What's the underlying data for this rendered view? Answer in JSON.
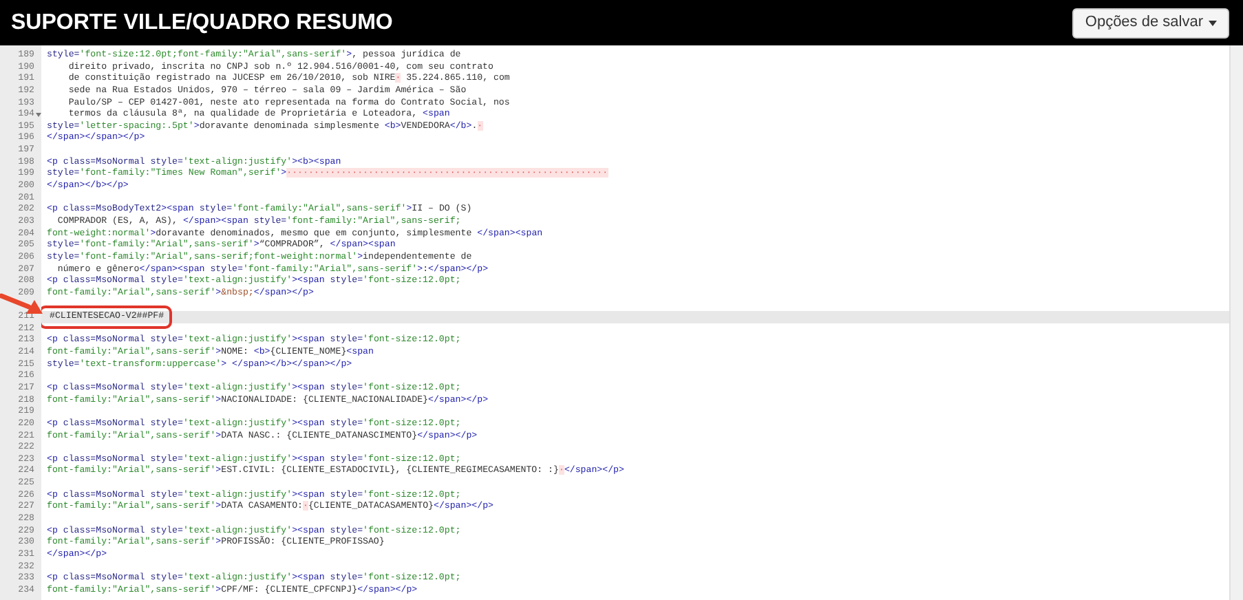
{
  "header": {
    "title": "SUPORTE VILLE/QUADRO RESUMO",
    "save_button": "Opções de salvar"
  },
  "editor": {
    "lines": [
      {
        "number": "189",
        "fold": false,
        "active": false,
        "boxed": false,
        "segments": [
          {
            "kind": "attr",
            "text": "style="
          },
          {
            "kind": "string",
            "text": "'font-size:12.0pt;font-family:\"Arial\",sans-serif'"
          },
          {
            "kind": "tag",
            "text": ">"
          },
          {
            "kind": "text",
            "text": ", pessoa jurídica de"
          }
        ]
      },
      {
        "number": "190",
        "fold": false,
        "active": false,
        "boxed": false,
        "segments": [
          {
            "kind": "text",
            "text": "    direito privado, inscrita no CNPJ sob n.º 12.904.516/0001-40, com seu contrato"
          }
        ]
      },
      {
        "number": "191",
        "fold": false,
        "active": false,
        "boxed": false,
        "segments": [
          {
            "kind": "text",
            "text": "    de constituição registrado na JUCESP em 26/10/2010, sob NIRE"
          },
          {
            "kind": "invisible",
            "text": "·"
          },
          {
            "kind": "text",
            "text": " 35.224.865.110, com"
          }
        ]
      },
      {
        "number": "192",
        "fold": false,
        "active": false,
        "boxed": false,
        "segments": [
          {
            "kind": "text",
            "text": "    sede na Rua Estados Unidos, 970 – térreo – sala 09 – Jardim América – São"
          }
        ]
      },
      {
        "number": "193",
        "fold": false,
        "active": false,
        "boxed": false,
        "segments": [
          {
            "kind": "text",
            "text": "    Paulo/SP – CEP 01427-001, neste ato representada na forma do Contrato Social, nos"
          }
        ]
      },
      {
        "number": "194",
        "fold": true,
        "active": false,
        "boxed": false,
        "segments": [
          {
            "kind": "text",
            "text": "    termos da cláusula 8ª, na qualidade de Proprietária e Loteadora, "
          },
          {
            "kind": "tag",
            "text": "<span"
          }
        ]
      },
      {
        "number": "195",
        "fold": false,
        "active": false,
        "boxed": false,
        "segments": [
          {
            "kind": "attr",
            "text": "style="
          },
          {
            "kind": "string",
            "text": "'letter-spacing:.5pt'"
          },
          {
            "kind": "tag",
            "text": ">"
          },
          {
            "kind": "text",
            "text": "doravante denominada simplesmente "
          },
          {
            "kind": "tag",
            "text": "<b>"
          },
          {
            "kind": "text",
            "text": "VENDEDORA"
          },
          {
            "kind": "tag",
            "text": "</b>"
          },
          {
            "kind": "text",
            "text": "."
          },
          {
            "kind": "invisible",
            "text": "·"
          }
        ]
      },
      {
        "number": "196",
        "fold": false,
        "active": false,
        "boxed": false,
        "segments": [
          {
            "kind": "tag",
            "text": "</span></span></p>"
          }
        ]
      },
      {
        "number": "197",
        "fold": false,
        "active": false,
        "boxed": false
      },
      {
        "number": "198",
        "fold": false,
        "active": false,
        "boxed": false,
        "segments": [
          {
            "kind": "tag",
            "text": "<p"
          },
          {
            "kind": "attr",
            "text": " class=MsoNormal style="
          },
          {
            "kind": "string",
            "text": "'text-align:justify'"
          },
          {
            "kind": "tag",
            "text": "><b><span"
          }
        ]
      },
      {
        "number": "199",
        "fold": false,
        "active": false,
        "boxed": false,
        "segments": [
          {
            "kind": "attr",
            "text": "style="
          },
          {
            "kind": "string",
            "text": "'font-family:\"Times New Roman\",serif'"
          },
          {
            "kind": "tag",
            "text": ">"
          },
          {
            "kind": "invisible",
            "text": "···························································"
          }
        ]
      },
      {
        "number": "200",
        "fold": false,
        "active": false,
        "boxed": false,
        "segments": [
          {
            "kind": "tag",
            "text": "</span></b></p>"
          }
        ]
      },
      {
        "number": "201",
        "fold": false,
        "active": false,
        "boxed": false
      },
      {
        "number": "202",
        "fold": false,
        "active": false,
        "boxed": false,
        "segments": [
          {
            "kind": "tag",
            "text": "<p"
          },
          {
            "kind": "attr",
            "text": " class=MsoBodyText2"
          },
          {
            "kind": "tag",
            "text": "><span"
          },
          {
            "kind": "attr",
            "text": " style="
          },
          {
            "kind": "string",
            "text": "'font-family:\"Arial\",sans-serif'"
          },
          {
            "kind": "tag",
            "text": ">"
          },
          {
            "kind": "text",
            "text": "II – DO (S)"
          }
        ]
      },
      {
        "number": "203",
        "fold": false,
        "active": false,
        "boxed": false,
        "segments": [
          {
            "kind": "text",
            "text": "  COMPRADOR (ES, A, AS), "
          },
          {
            "kind": "tag",
            "text": "</span><span"
          },
          {
            "kind": "attr",
            "text": " style="
          },
          {
            "kind": "string",
            "text": "'font-family:\"Arial\",sans-serif;"
          }
        ]
      },
      {
        "number": "204",
        "fold": false,
        "active": false,
        "boxed": false,
        "segments": [
          {
            "kind": "string",
            "text": "font-weight:normal'"
          },
          {
            "kind": "tag",
            "text": ">"
          },
          {
            "kind": "text",
            "text": "doravante denominados, mesmo que em conjunto, simplesmente "
          },
          {
            "kind": "tag",
            "text": "</span><span"
          }
        ]
      },
      {
        "number": "205",
        "fold": false,
        "active": false,
        "boxed": false,
        "segments": [
          {
            "kind": "attr",
            "text": "style="
          },
          {
            "kind": "string",
            "text": "'font-family:\"Arial\",sans-serif'"
          },
          {
            "kind": "tag",
            "text": ">"
          },
          {
            "kind": "text",
            "text": "“COMPRADOR”, "
          },
          {
            "kind": "tag",
            "text": "</span><span"
          }
        ]
      },
      {
        "number": "206",
        "fold": false,
        "active": false,
        "boxed": false,
        "segments": [
          {
            "kind": "attr",
            "text": "style="
          },
          {
            "kind": "string",
            "text": "'font-family:\"Arial\",sans-serif;font-weight:normal'"
          },
          {
            "kind": "tag",
            "text": ">"
          },
          {
            "kind": "text",
            "text": "independentemente de"
          }
        ]
      },
      {
        "number": "207",
        "fold": false,
        "active": false,
        "boxed": false,
        "segments": [
          {
            "kind": "text",
            "text": "  número e gênero"
          },
          {
            "kind": "tag",
            "text": "</span><span"
          },
          {
            "kind": "attr",
            "text": " style="
          },
          {
            "kind": "string",
            "text": "'font-family:\"Arial\",sans-serif'"
          },
          {
            "kind": "tag",
            "text": ">"
          },
          {
            "kind": "text",
            "text": ":"
          },
          {
            "kind": "tag",
            "text": "</span></p>"
          }
        ]
      },
      {
        "number": "208",
        "fold": false,
        "active": false,
        "boxed": false,
        "segments": [
          {
            "kind": "tag",
            "text": "<p"
          },
          {
            "kind": "attr",
            "text": " class=MsoNormal style="
          },
          {
            "kind": "string",
            "text": "'text-align:justify'"
          },
          {
            "kind": "tag",
            "text": "><span"
          },
          {
            "kind": "attr",
            "text": " style="
          },
          {
            "kind": "string",
            "text": "'font-size:12.0pt;"
          }
        ]
      },
      {
        "number": "209",
        "fold": false,
        "active": false,
        "boxed": false,
        "segments": [
          {
            "kind": "string",
            "text": "font-family:\"Arial\",sans-serif'"
          },
          {
            "kind": "tag",
            "text": ">"
          },
          {
            "kind": "entity",
            "text": "&nbsp;"
          },
          {
            "kind": "tag",
            "text": "</span></p>"
          }
        ]
      },
      {
        "fold": false,
        "active": false,
        "boxed": false
      },
      {
        "number": "211",
        "fold": false,
        "active": true,
        "boxed": true,
        "segments": [
          {
            "kind": "text",
            "text": "#CLIENTESECAO-V2##PF#"
          }
        ]
      },
      {
        "number": "212",
        "fold": false,
        "active": false,
        "boxed": false
      },
      {
        "number": "213",
        "fold": false,
        "active": false,
        "boxed": false,
        "segments": [
          {
            "kind": "tag",
            "text": "<p"
          },
          {
            "kind": "attr",
            "text": " class=MsoNormal style="
          },
          {
            "kind": "string",
            "text": "'text-align:justify'"
          },
          {
            "kind": "tag",
            "text": "><span"
          },
          {
            "kind": "attr",
            "text": " style="
          },
          {
            "kind": "string",
            "text": "'font-size:12.0pt;"
          }
        ]
      },
      {
        "number": "214",
        "fold": false,
        "active": false,
        "boxed": false,
        "segments": [
          {
            "kind": "string",
            "text": "font-family:\"Arial\",sans-serif'"
          },
          {
            "kind": "tag",
            "text": ">"
          },
          {
            "kind": "text",
            "text": "NOME: "
          },
          {
            "kind": "tag",
            "text": "<b>"
          },
          {
            "kind": "text",
            "text": "{CLIENTE_NOME}"
          },
          {
            "kind": "tag",
            "text": "<span"
          }
        ]
      },
      {
        "number": "215",
        "fold": false,
        "active": false,
        "boxed": false,
        "segments": [
          {
            "kind": "attr",
            "text": "style="
          },
          {
            "kind": "string",
            "text": "'text-transform:uppercase'"
          },
          {
            "kind": "tag",
            "text": "> </span></b></span></p>"
          }
        ]
      },
      {
        "number": "216",
        "fold": false,
        "active": false,
        "boxed": false
      },
      {
        "number": "217",
        "fold": false,
        "active": false,
        "boxed": false,
        "segments": [
          {
            "kind": "tag",
            "text": "<p"
          },
          {
            "kind": "attr",
            "text": " class=MsoNormal style="
          },
          {
            "kind": "string",
            "text": "'text-align:justify'"
          },
          {
            "kind": "tag",
            "text": "><span"
          },
          {
            "kind": "attr",
            "text": " style="
          },
          {
            "kind": "string",
            "text": "'font-size:12.0pt;"
          }
        ]
      },
      {
        "number": "218",
        "fold": false,
        "active": false,
        "boxed": false,
        "segments": [
          {
            "kind": "string",
            "text": "font-family:\"Arial\",sans-serif'"
          },
          {
            "kind": "tag",
            "text": ">"
          },
          {
            "kind": "text",
            "text": "NACIONALIDADE: {CLIENTE_NACIONALIDADE}"
          },
          {
            "kind": "tag",
            "text": "</span></p>"
          }
        ]
      },
      {
        "number": "219",
        "fold": false,
        "active": false,
        "boxed": false
      },
      {
        "number": "220",
        "fold": false,
        "active": false,
        "boxed": false,
        "segments": [
          {
            "kind": "tag",
            "text": "<p"
          },
          {
            "kind": "attr",
            "text": " class=MsoNormal style="
          },
          {
            "kind": "string",
            "text": "'text-align:justify'"
          },
          {
            "kind": "tag",
            "text": "><span"
          },
          {
            "kind": "attr",
            "text": " style="
          },
          {
            "kind": "string",
            "text": "'font-size:12.0pt;"
          }
        ]
      },
      {
        "number": "221",
        "fold": false,
        "active": false,
        "boxed": false,
        "segments": [
          {
            "kind": "string",
            "text": "font-family:\"Arial\",sans-serif'"
          },
          {
            "kind": "tag",
            "text": ">"
          },
          {
            "kind": "text",
            "text": "DATA NASC.: {CLIENTE_DATANASCIMENTO}"
          },
          {
            "kind": "tag",
            "text": "</span></p>"
          }
        ]
      },
      {
        "number": "222",
        "fold": false,
        "active": false,
        "boxed": false
      },
      {
        "number": "223",
        "fold": false,
        "active": false,
        "boxed": false,
        "segments": [
          {
            "kind": "tag",
            "text": "<p"
          },
          {
            "kind": "attr",
            "text": " class=MsoNormal style="
          },
          {
            "kind": "string",
            "text": "'text-align:justify'"
          },
          {
            "kind": "tag",
            "text": "><span"
          },
          {
            "kind": "attr",
            "text": " style="
          },
          {
            "kind": "string",
            "text": "'font-size:12.0pt;"
          }
        ]
      },
      {
        "number": "224",
        "fold": false,
        "active": false,
        "boxed": false,
        "segments": [
          {
            "kind": "string",
            "text": "font-family:\"Arial\",sans-serif'"
          },
          {
            "kind": "tag",
            "text": ">"
          },
          {
            "kind": "text",
            "text": "EST.CIVIL: {CLIENTE_ESTADOCIVIL}, {CLIENTE_REGIMECASAMENTO: :}"
          },
          {
            "kind": "invisible",
            "text": "·"
          },
          {
            "kind": "tag",
            "text": "</span></p>"
          }
        ]
      },
      {
        "number": "225",
        "fold": false,
        "active": false,
        "boxed": false
      },
      {
        "number": "226",
        "fold": false,
        "active": false,
        "boxed": false,
        "segments": [
          {
            "kind": "tag",
            "text": "<p"
          },
          {
            "kind": "attr",
            "text": " class=MsoNormal style="
          },
          {
            "kind": "string",
            "text": "'text-align:justify'"
          },
          {
            "kind": "tag",
            "text": "><span"
          },
          {
            "kind": "attr",
            "text": " style="
          },
          {
            "kind": "string",
            "text": "'font-size:12.0pt;"
          }
        ]
      },
      {
        "number": "227",
        "fold": false,
        "active": false,
        "boxed": false,
        "segments": [
          {
            "kind": "string",
            "text": "font-family:\"Arial\",sans-serif'"
          },
          {
            "kind": "tag",
            "text": ">"
          },
          {
            "kind": "text",
            "text": "DATA CASAMENTO:"
          },
          {
            "kind": "invisible",
            "text": "·"
          },
          {
            "kind": "text",
            "text": "{CLIENTE_DATACASAMENTO}"
          },
          {
            "kind": "tag",
            "text": "</span></p>"
          }
        ]
      },
      {
        "number": "228",
        "fold": false,
        "active": false,
        "boxed": false
      },
      {
        "number": "229",
        "fold": false,
        "active": false,
        "boxed": false,
        "segments": [
          {
            "kind": "tag",
            "text": "<p"
          },
          {
            "kind": "attr",
            "text": " class=MsoNormal style="
          },
          {
            "kind": "string",
            "text": "'text-align:justify'"
          },
          {
            "kind": "tag",
            "text": "><span"
          },
          {
            "kind": "attr",
            "text": " style="
          },
          {
            "kind": "string",
            "text": "'font-size:12.0pt;"
          }
        ]
      },
      {
        "number": "230",
        "fold": false,
        "active": false,
        "boxed": false,
        "segments": [
          {
            "kind": "string",
            "text": "font-family:\"Arial\",sans-serif'"
          },
          {
            "kind": "tag",
            "text": ">"
          },
          {
            "kind": "text",
            "text": "PROFISSÃO: {CLIENTE_PROFISSAO}"
          }
        ]
      },
      {
        "number": "231",
        "fold": false,
        "active": false,
        "boxed": false,
        "segments": [
          {
            "kind": "tag",
            "text": "</span></p>"
          }
        ]
      },
      {
        "number": "232",
        "fold": false,
        "active": false,
        "boxed": false
      },
      {
        "number": "233",
        "fold": false,
        "active": false,
        "boxed": false,
        "segments": [
          {
            "kind": "tag",
            "text": "<p"
          },
          {
            "kind": "attr",
            "text": " class=MsoNormal style="
          },
          {
            "kind": "string",
            "text": "'text-align:justify'"
          },
          {
            "kind": "tag",
            "text": "><span"
          },
          {
            "kind": "attr",
            "text": " style="
          },
          {
            "kind": "string",
            "text": "'font-size:12.0pt;"
          }
        ]
      },
      {
        "number": "234",
        "fold": false,
        "active": false,
        "boxed": false,
        "segments": [
          {
            "kind": "string",
            "text": "font-family:\"Arial\",sans-serif'"
          },
          {
            "kind": "tag",
            "text": ">"
          },
          {
            "kind": "text",
            "text": "CPF/MF: {CLIENTE_CPFCNPJ}"
          },
          {
            "kind": "tag",
            "text": "</span></p>"
          }
        ]
      }
    ]
  }
}
